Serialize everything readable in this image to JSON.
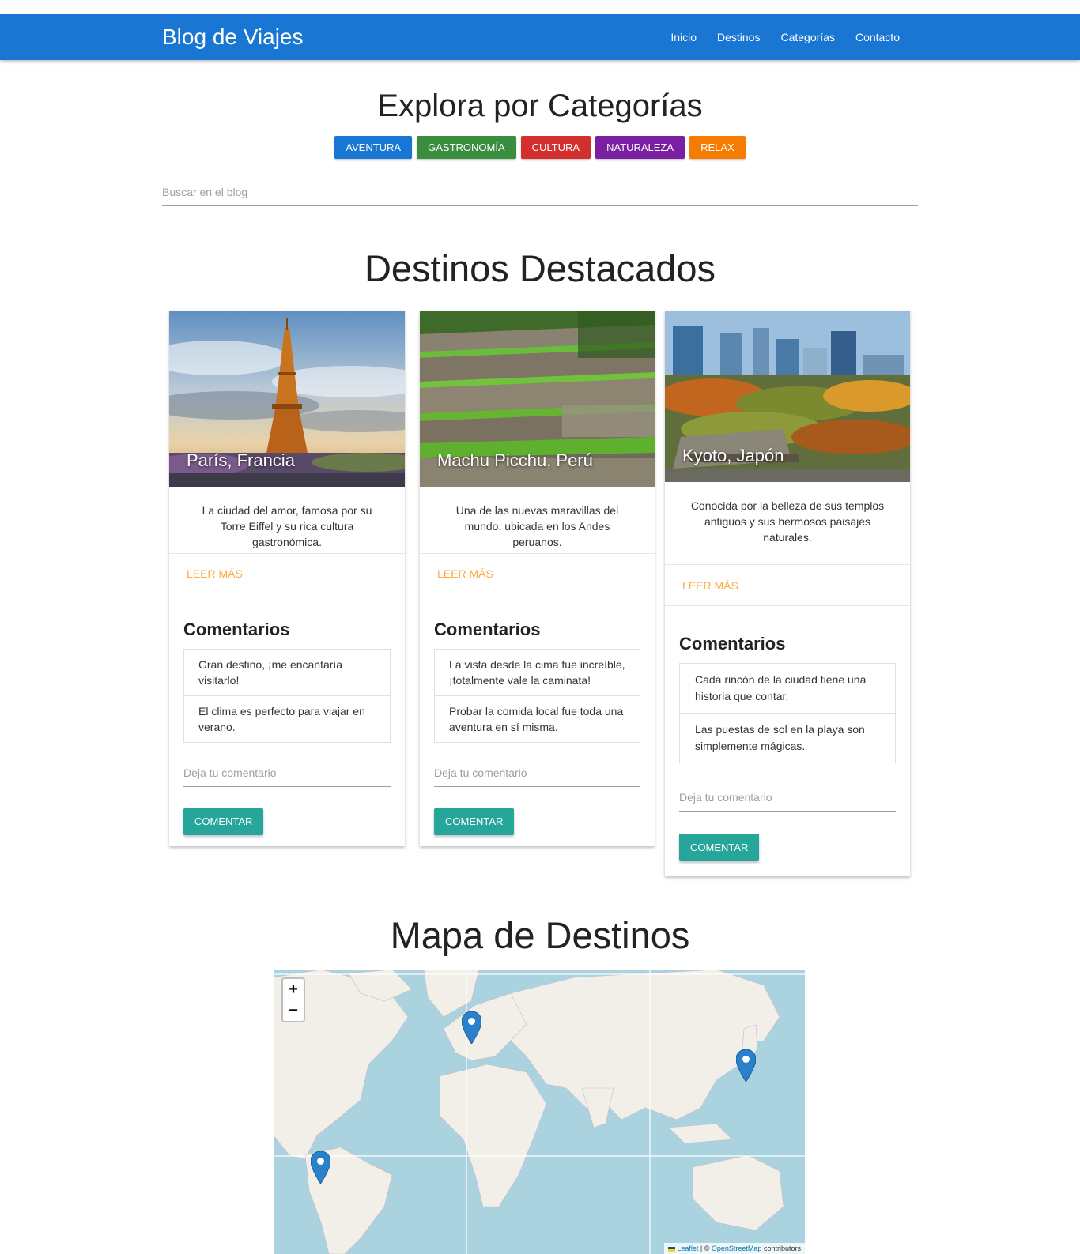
{
  "nav": {
    "brand": "Blog de Viajes",
    "links": [
      "Inicio",
      "Destinos",
      "Categorías",
      "Contacto"
    ]
  },
  "categories": {
    "title": "Explora por Categorías",
    "chips": [
      {
        "label": "Aventura",
        "color": "#1976d2"
      },
      {
        "label": "Gastronomía",
        "color": "#388e3c"
      },
      {
        "label": "Cultura",
        "color": "#d32f2f"
      },
      {
        "label": "Naturaleza",
        "color": "#7b1fa2"
      },
      {
        "label": "Relax",
        "color": "#f57c00"
      }
    ]
  },
  "search": {
    "placeholder": "Buscar en el blog"
  },
  "featured": {
    "title": "Destinos Destacados",
    "cards": [
      {
        "title": "París, Francia",
        "description": "La ciudad del amor, famosa por su Torre Eiffel y su rica cultura gastronómica.",
        "action": "Leer más",
        "comments_title": "Comentarios",
        "comments": [
          "Gran destino, ¡me encantaría visitarlo!",
          "El clima es perfecto para viajar en verano."
        ],
        "comment_placeholder": "Deja tu comentario",
        "button": "Comentar"
      },
      {
        "title": "Machu Picchu, Perú",
        "description": "Una de las nuevas maravillas del mundo, ubicada en los Andes peruanos.",
        "action": "Leer más",
        "comments_title": "Comentarios",
        "comments": [
          "La vista desde la cima fue increíble, ¡totalmente vale la caminata!",
          "Probar la comida local fue toda una aventura en sí misma."
        ],
        "comment_placeholder": "Deja tu comentario",
        "button": "Comentar"
      },
      {
        "title": "Kyoto, Japón",
        "description": "Conocida por la belleza de sus templos antiguos y sus hermosos paisajes naturales.",
        "action": "Leer más",
        "comments_title": "Comentarios",
        "comments": [
          "Cada rincón de la ciudad tiene una historia que contar.",
          "Las puestas de sol en la playa son simplemente mágicas."
        ],
        "comment_placeholder": "Deja tu comentario",
        "button": "Comentar"
      }
    ]
  },
  "map": {
    "title": "Mapa de Destinos",
    "zoom_in": "+",
    "zoom_out": "−",
    "attribution": {
      "leaflet": "Leaflet",
      "separator": "| ©",
      "osm": "OpenStreetMap",
      "suffix": "contributors"
    },
    "marker_icon": "map-pin-icon",
    "colors": {
      "water": "#aad3df",
      "land": "#f2efe9",
      "marker": "#2a81cb"
    }
  }
}
